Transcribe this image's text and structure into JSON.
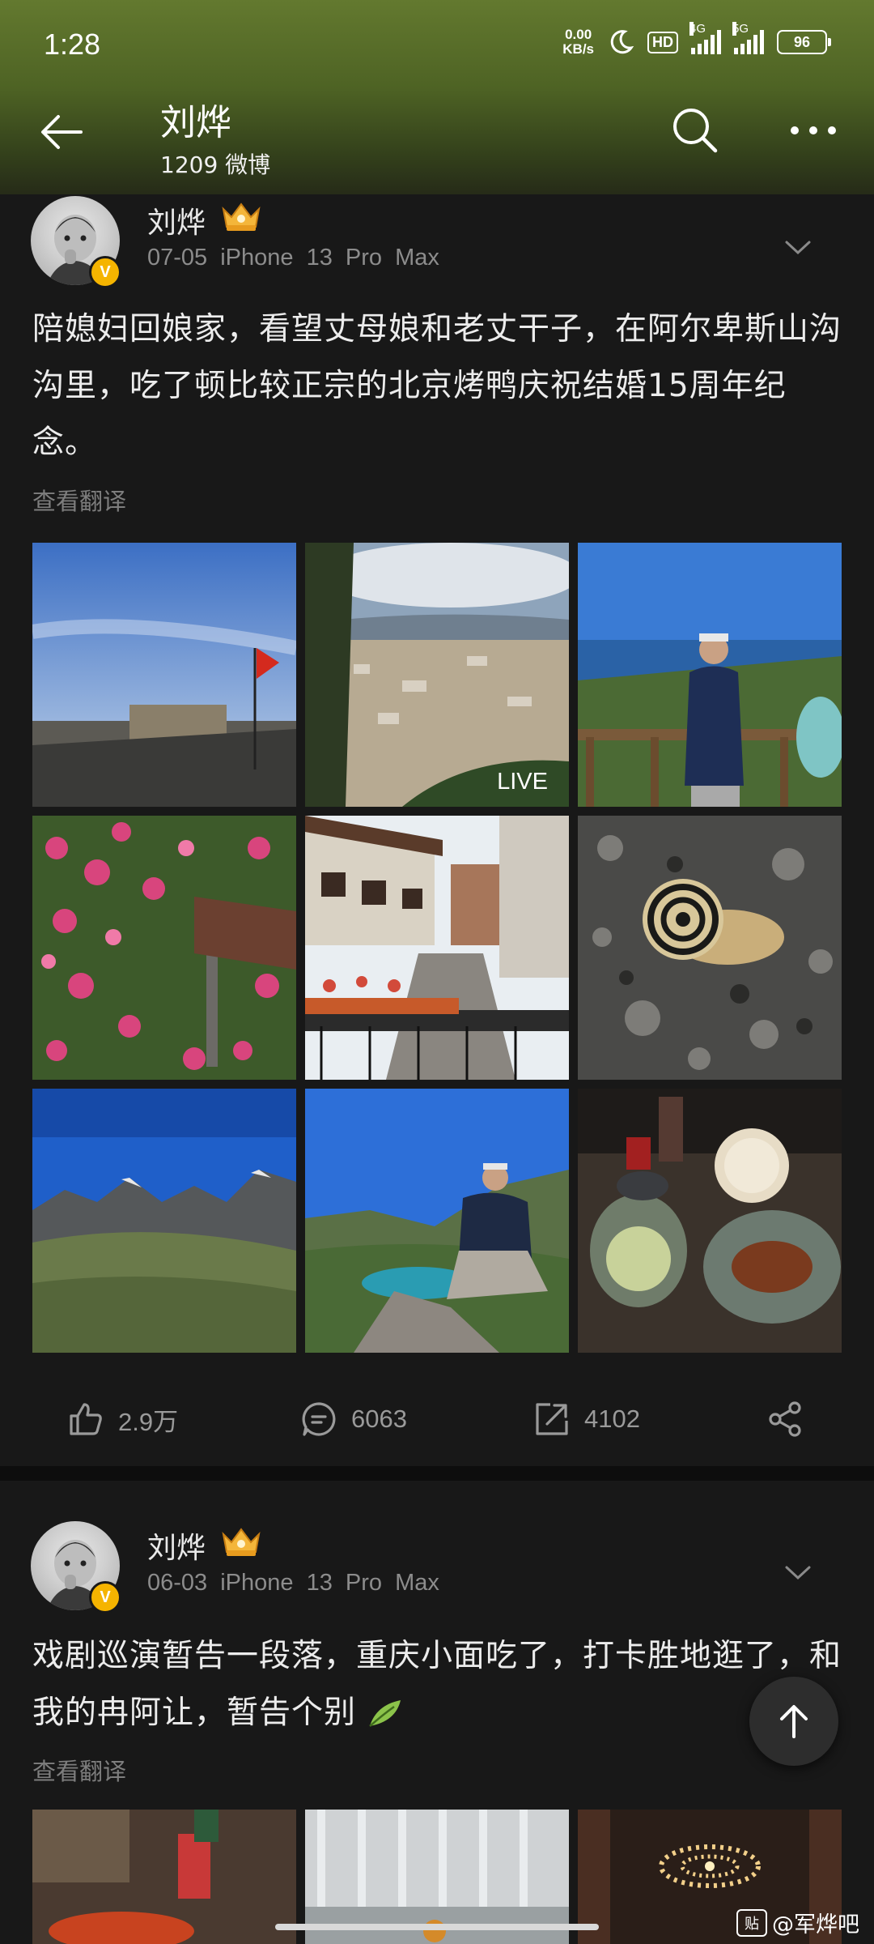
{
  "status_bar": {
    "time": "1:28",
    "net_speed_value": "0.00",
    "net_speed_unit": "KB/s",
    "hd_label": "HD",
    "sim1_label": "4G",
    "sim2_label": "5G",
    "battery": "96"
  },
  "header": {
    "title": "刘烨",
    "subtitle": "1209 微博"
  },
  "posts": [
    {
      "username": "刘烨",
      "date": "07-05",
      "device": "iPhone 13 Pro Max",
      "text": "陪媳妇回娘家，看望丈母娘和老丈干子，在阿尔卑斯山沟沟里，吃了顿比较正宗的北京烤鸭庆祝结婚15周年纪念。",
      "translate": "查看翻译",
      "live_label": "LIVE",
      "actions": {
        "likes": "2.9万",
        "comments": "6063",
        "reposts": "4102"
      }
    },
    {
      "username": "刘烨",
      "date": "06-03",
      "device": "iPhone 13 Pro Max",
      "text": "戏剧巡演暂告一段落，重庆小面吃了，打卡胜地逛了，和我的冉阿让，暂告个别",
      "translate": "查看翻译"
    }
  ],
  "badge": {
    "verified": "V"
  },
  "watermark": {
    "logo": "贴",
    "text": "@军烨吧"
  },
  "colors": {
    "verified": "#f5b400",
    "header_top": "#63792f",
    "background": "#161616"
  }
}
